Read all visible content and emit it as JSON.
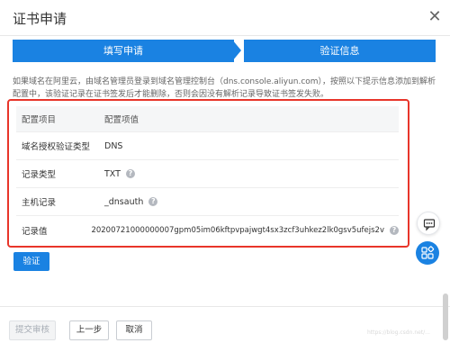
{
  "dialog": {
    "title": "证书申请"
  },
  "steps": [
    {
      "label": "填写申请"
    },
    {
      "label": "验证信息"
    }
  ],
  "notice": "如果域名在阿里云，由域名管理员登录到域名管理控制台（dns.console.aliyun.com），按照以下提示信息添加到解析配置中，该验证记录在证书签发后才能删除，否则会因没有解析记录导致证书签发失败。",
  "table": {
    "headers": [
      "配置项目",
      "配置项值"
    ],
    "rows": [
      {
        "key": "域名授权验证类型",
        "value": "DNS",
        "help": false
      },
      {
        "key": "记录类型",
        "value": "TXT",
        "help": true
      },
      {
        "key": "主机记录",
        "value": "_dnsauth",
        "help": true
      },
      {
        "key": "记录值",
        "value": "20200721000000007gpm05im06kftpvpajwgt4sx3zcf3uhkez2lk0gsv5ufejs2v",
        "help": true
      }
    ]
  },
  "buttons": {
    "verify": "验证",
    "submit": "提交审核",
    "prev": "上一步",
    "cancel": "取消"
  },
  "watermark": "https://blog.csdn.net/..."
}
